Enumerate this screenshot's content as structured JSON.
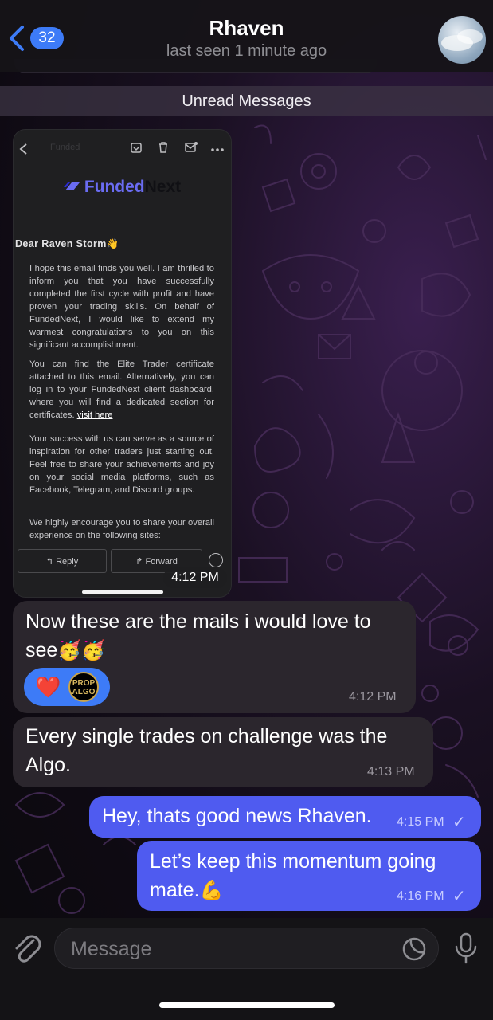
{
  "header": {
    "back_count": "32",
    "title": "Rhaven",
    "subtitle": "last seen 1 minute ago"
  },
  "unread_label": "Unread Messages",
  "screenshot_message": {
    "email": {
      "brand_part1": "Funded",
      "brand_part2": "Next",
      "greeting": "Dear Raven Storm",
      "greeting_emoji": "👋",
      "paragraph1": "I hope this email finds you well. I am thrilled to inform you that you have successfully completed the first cycle with profit and have proven your trading skills. On behalf of FundedNext, I would like to extend my warmest congratulations to you on this significant accomplishment.",
      "paragraph2": "You can find the Elite Trader certificate attached to this email. Alternatively, you can log in to your FundedNext client dashboard, where you will find a dedicated section for certificates.",
      "paragraph2_link": "visit here",
      "paragraph3": "Your success with us can serve as a source of inspiration for other traders just starting out. Feel free to share your achievements and joy on your social media platforms, such as Facebook, Telegram, and Discord groups.",
      "paragraph4": "We highly encourage you to share your overall experience on the following sites:",
      "reply_label": "Reply",
      "forward_label": "Forward"
    },
    "time": "4:12 PM"
  },
  "messages": [
    {
      "id": "m1",
      "direction": "incoming",
      "text": "Now these are the mails i would love to see",
      "emojis": "🥳🥳",
      "time": "4:12 PM",
      "reactions": [
        "❤️",
        "PROP ALGO"
      ]
    },
    {
      "id": "m2",
      "direction": "incoming",
      "text": "Every single trades on challenge was the Algo.",
      "time": "4:13 PM"
    },
    {
      "id": "m3",
      "direction": "outgoing",
      "text": "Hey, thats good news Rhaven.",
      "time": "4:15 PM",
      "read_mark": "✓"
    },
    {
      "id": "m4",
      "direction": "outgoing",
      "text": "Let’s keep this momentum going mate.",
      "emojis": "💪",
      "time": "4:16 PM",
      "read_mark": "✓"
    }
  ],
  "reaction_badge": {
    "line1": "PROP",
    "line2": "ALGO"
  },
  "composer": {
    "placeholder": "Message"
  },
  "colors": {
    "accent": "#3d7bf7",
    "outgoing_bubble": "#4f5bf0",
    "incoming_bubble": "#2b262d"
  }
}
